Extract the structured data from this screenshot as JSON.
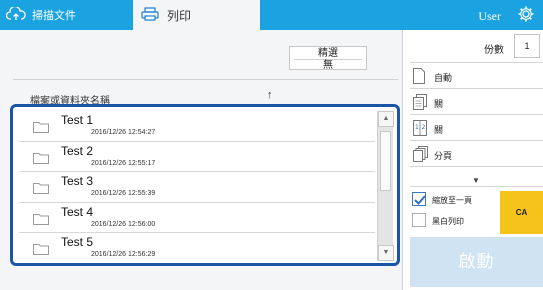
{
  "tabs": {
    "scan_label": "掃描文件",
    "print_label": "列印"
  },
  "header": {
    "user_label": "User",
    "gear_icon": "gear-icon"
  },
  "filter": {
    "title": "精選",
    "value": "無"
  },
  "file_list": {
    "name_header": "檔案或資料夾名稱",
    "sort_arrow": "↑",
    "items": [
      {
        "name": "Test 1",
        "date": "2016/12/26 12:54:27"
      },
      {
        "name": "Test 2",
        "date": "2016/12/26 12:55:17"
      },
      {
        "name": "Test 3",
        "date": "2016/12/26 12:55:39"
      },
      {
        "name": "Test 4",
        "date": "2016/12/26 12:56:00"
      },
      {
        "name": "Test 5",
        "date": "2016/12/26 12:56:29"
      }
    ],
    "scroll_up": "▲",
    "scroll_down": "▼"
  },
  "settings": {
    "copies_label": "份數",
    "copies_value": "1",
    "items": [
      {
        "label": "自動",
        "icon": "page-icon"
      },
      {
        "label": "關",
        "icon": "duplex-icon"
      },
      {
        "label": "關",
        "icon": "nup-icon"
      },
      {
        "label": "分頁",
        "icon": "collate-icon"
      }
    ],
    "more_arrow": "▼",
    "fit_to_page_label": "縮放至一頁",
    "fit_to_page_checked": true,
    "mono_label": "黑白列印",
    "mono_checked": false,
    "ca_label": "CA",
    "start_label": "啟動"
  },
  "colors": {
    "topbar": "#1aa3e0",
    "list_frame": "#1a55a6",
    "ca_box": "#f5c31a",
    "start_disabled": "#cfe3f2"
  }
}
